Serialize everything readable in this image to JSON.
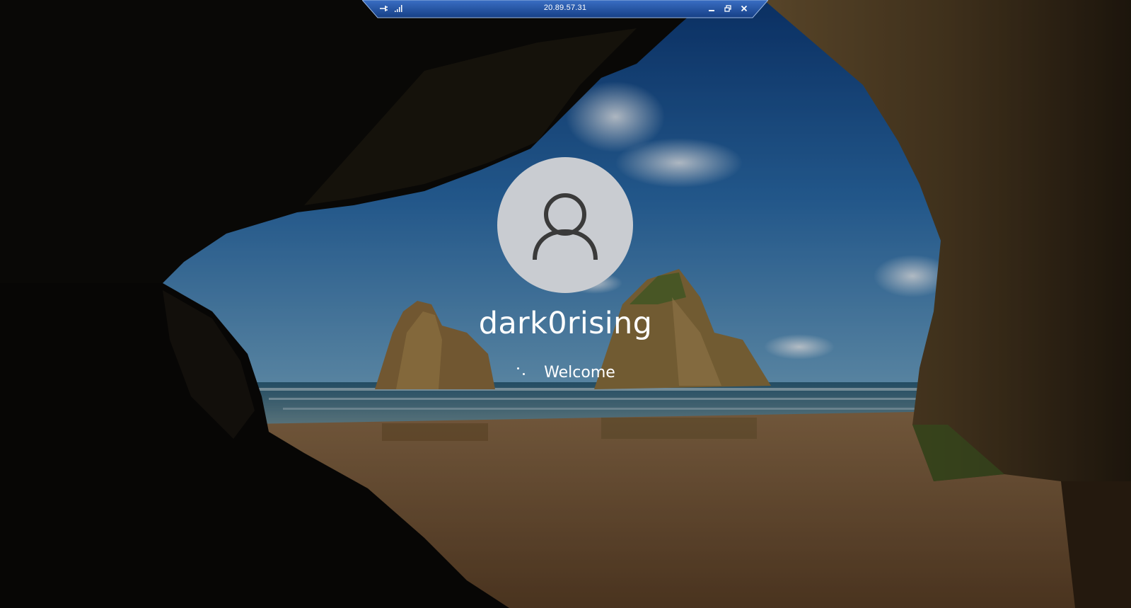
{
  "rdp_bar": {
    "title": "20.89.57.31",
    "pin_icon": "pin-icon",
    "signal_icon": "signal-strength-icon",
    "minimize_icon": "minimize-icon",
    "restore_icon": "restore-icon",
    "close_icon": "close-icon"
  },
  "login": {
    "username": "dark0rising",
    "status": "Welcome",
    "avatar_icon": "user-avatar-icon",
    "spinner_icon": "loading-spinner-icon"
  },
  "colors": {
    "rdp_bar": "#1f4f9c",
    "avatar_bg": "#c9ccd1",
    "avatar_glyph": "#3a3a3a",
    "text": "#ffffff"
  }
}
